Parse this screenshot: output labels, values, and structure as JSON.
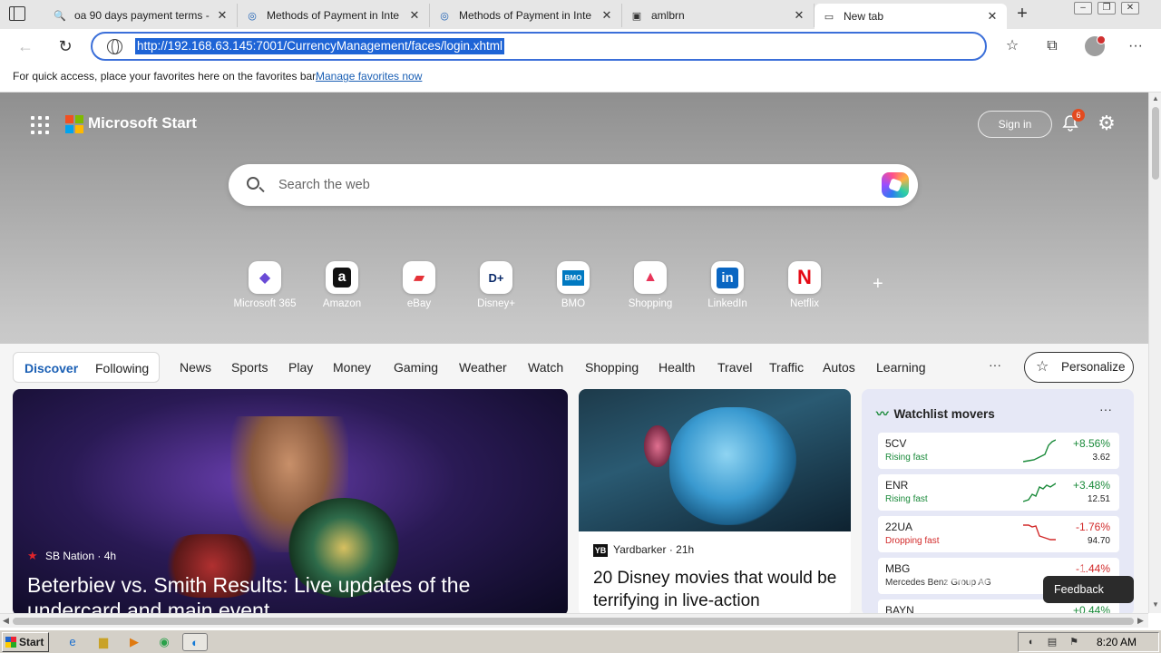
{
  "browser": {
    "tabs": [
      {
        "title": "oa 90 days payment terms -",
        "icon": "search-icon"
      },
      {
        "title": "Methods of Payment in Inte",
        "icon": "site-icon"
      },
      {
        "title": "Methods of Payment in Inte",
        "icon": "site-icon"
      },
      {
        "title": "amlbrn",
        "icon": "page-icon"
      },
      {
        "title": "New tab",
        "icon": "newtab-icon"
      }
    ],
    "url": "http://192.168.63.145:7001/CurrencyManagement/faces/login.xhtml",
    "favorites_bar": {
      "message": "For quick access, place your favorites here on the favorites bar.",
      "link": "Manage favorites now"
    }
  },
  "start": {
    "brand": "Microsoft Start",
    "sign_in": "Sign in",
    "notification_count": "6",
    "search_placeholder": "Search the web",
    "quick_links": [
      {
        "label": "Microsoft 365",
        "glyph": "◆",
        "color": "#6a4bd6"
      },
      {
        "label": "Amazon",
        "glyph": "a",
        "color": "#111111"
      },
      {
        "label": "eBay",
        "glyph": "▰",
        "color": "#e53238"
      },
      {
        "label": "Disney+",
        "glyph": "D+",
        "color": "#0a2a6a"
      },
      {
        "label": "BMO",
        "glyph": "BMO",
        "color": "#0079c1"
      },
      {
        "label": "Shopping",
        "glyph": "▲",
        "color": "#e8355a"
      },
      {
        "label": "LinkedIn",
        "glyph": "in",
        "color": "#0a66c2"
      },
      {
        "label": "Netflix",
        "glyph": "N",
        "color": "#e50914"
      }
    ],
    "feed_nav": {
      "discover": "Discover",
      "following": "Following",
      "categories": [
        "News",
        "Sports",
        "Play",
        "Money",
        "Gaming",
        "Weather",
        "Watch",
        "Shopping",
        "Health",
        "Travel",
        "Traffic",
        "Autos",
        "Learning"
      ],
      "more": "···",
      "personalize": "Personalize"
    },
    "hero": {
      "source": "SB Nation",
      "age": "4h",
      "headline": "Beterbiev vs. Smith Results: Live updates of the undercard and main event"
    },
    "card2": {
      "source": "Yardbarker",
      "age": "21h",
      "headline": "20 Disney movies that would be terrifying in live-action"
    },
    "watchlist": {
      "title": "Watchlist movers",
      "more": "···",
      "items": [
        {
          "symbol": "5CV",
          "status": "Rising fast",
          "change": "+8.56%",
          "price": "3.62",
          "direction": "up"
        },
        {
          "symbol": "ENR",
          "status": "Rising fast",
          "change": "+3.48%",
          "price": "12.51",
          "direction": "up"
        },
        {
          "symbol": "22UA",
          "status": "Dropping fast",
          "change": "-1.76%",
          "price": "94.70",
          "direction": "down"
        },
        {
          "symbol": "MBG",
          "status": "Mercedes Benz Group AG",
          "change": "-1.44%",
          "price": "",
          "direction": "down"
        },
        {
          "symbol": "BAYN",
          "status": "",
          "change": "+0.44%",
          "price": "",
          "direction": "up"
        }
      ]
    },
    "feedback": "Feedback"
  },
  "taskbar": {
    "start": "Start",
    "clock": "8:20 AM"
  },
  "watermark": "ANY.RUN"
}
